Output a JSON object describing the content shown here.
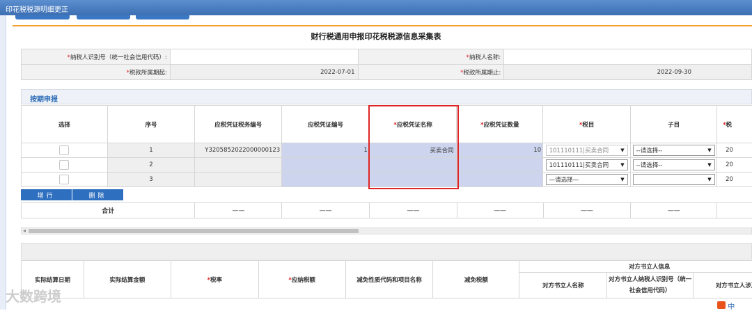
{
  "window": {
    "title": "印花税税源明细更正"
  },
  "page": {
    "title": "财行税通用申报印花税税源信息采集表"
  },
  "info": {
    "taxpayer_id_label": "纳税人识别号（统一社会信用代码）:",
    "taxpayer_name_label": "纳税人名称:",
    "period_start_label": "税款所属期起:",
    "period_start_value": "2022-07-01",
    "period_end_label": "税款所属期止:",
    "period_end_value": "2022-09-30",
    "required_mark": "*"
  },
  "section": {
    "title": "按期申报"
  },
  "grid": {
    "headers": [
      "选择",
      "序号",
      "应税凭证税务编号",
      "应税凭证编号",
      "应税凭证名称",
      "应税凭证数量",
      "税目",
      "子目",
      "税"
    ],
    "rows": [
      {
        "no": "1",
        "tax_no": "Y3205852022000000123",
        "voucher_no": "1",
        "voucher_name": "买卖合同",
        "qty": "10",
        "item": "101110111|买卖合同",
        "sub": "--请选择--",
        "rate": "20"
      },
      {
        "no": "2",
        "tax_no": "",
        "voucher_no": "",
        "voucher_name": "",
        "qty": "",
        "item": "101110111|买卖合同",
        "sub": "--请选择--",
        "rate": "20"
      },
      {
        "no": "3",
        "tax_no": "",
        "voucher_no": "",
        "voucher_name": "",
        "qty": "",
        "item": "—请选择—",
        "sub": "",
        "rate": "20"
      }
    ],
    "add_row_label": "增行",
    "delete_row_label": "删除",
    "total_label": "合计",
    "total_dash": "——"
  },
  "grid2": {
    "headers": [
      "实际结算日期",
      "实际结算金额",
      "税率",
      "应纳税额",
      "减免性质代码和项目名称",
      "减免税额"
    ],
    "counterparty_group": "对方书立人信息",
    "counterparty_name": "对方书立人名称",
    "counterparty_id": "对方书立人纳税人识别号（统一社会信用代码）",
    "counterparty_amount": "对方书立人涉及"
  },
  "watermark": "大数跨境",
  "corner_label": "中"
}
